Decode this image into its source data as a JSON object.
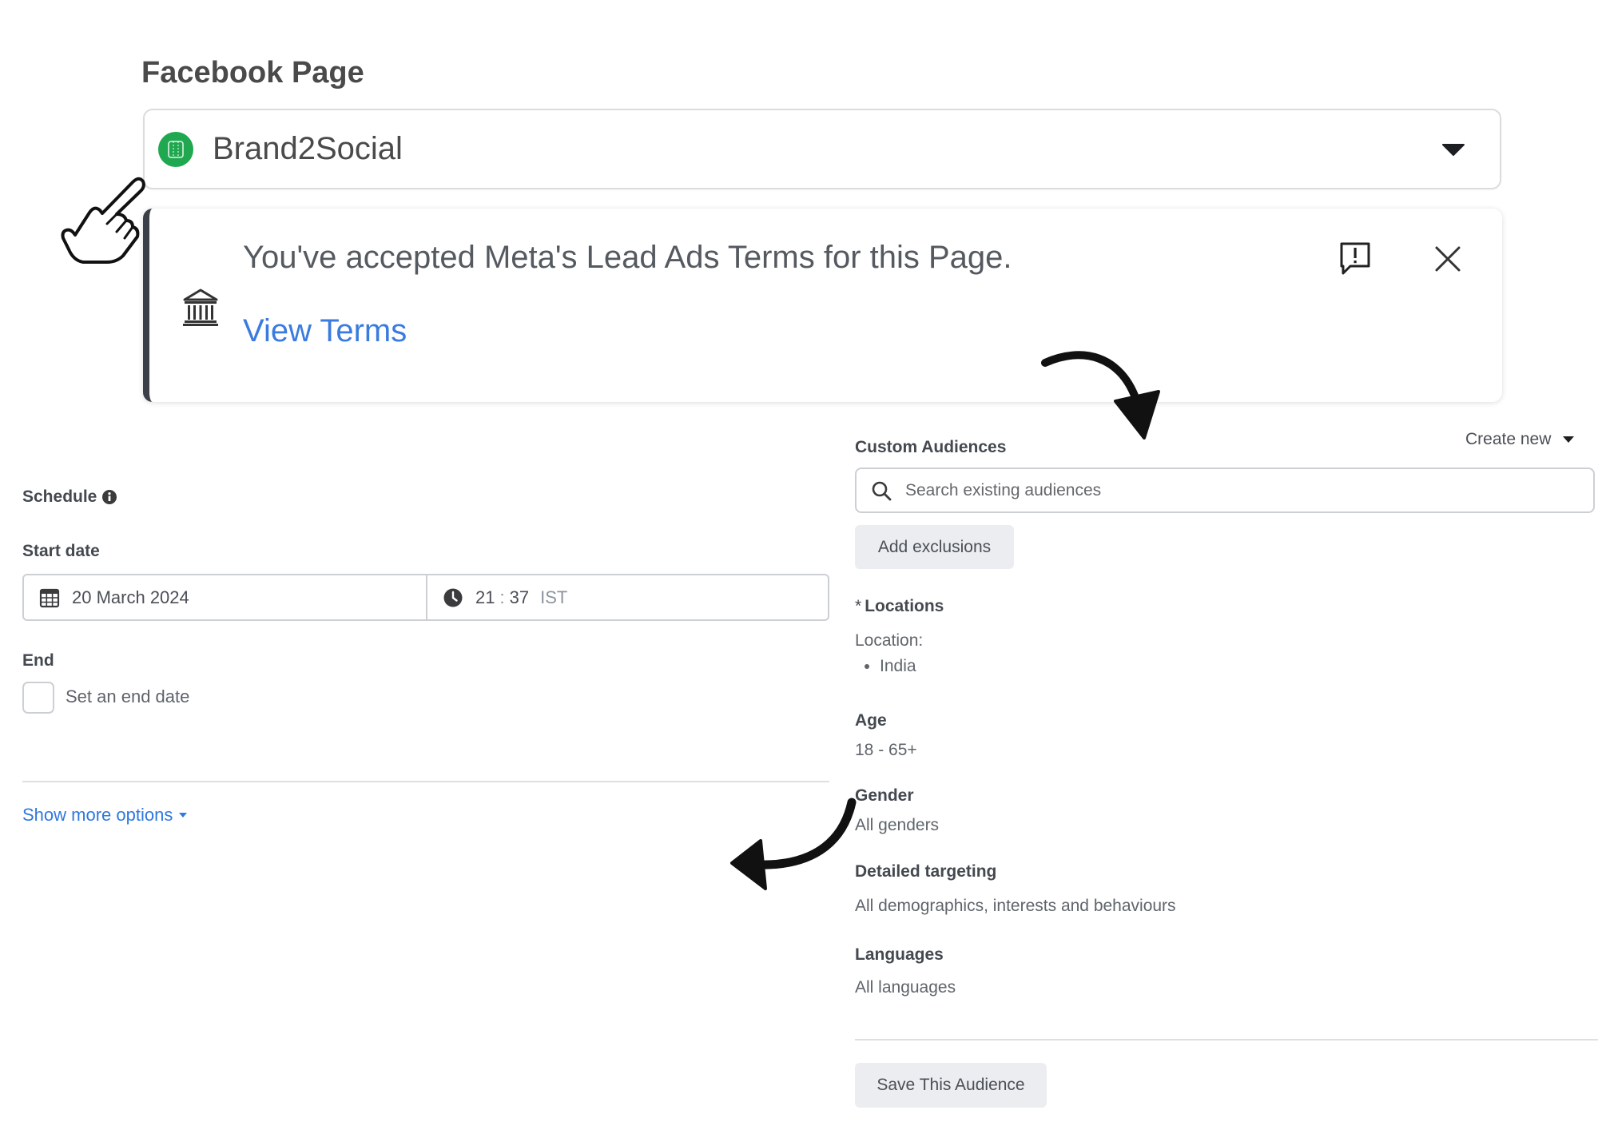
{
  "facebook_page": {
    "heading": "Facebook Page",
    "selected_page": "Brand2Social",
    "avatar_color": "#1fa84f",
    "dropdown_icon": "caret-down-icon"
  },
  "terms_notice": {
    "message": "You've accepted Meta's Lead Ads Terms for this Page.",
    "link_label": "View Terms",
    "link_color": "#3a7be0",
    "accent_color": "#3b4048",
    "icons": [
      "bank-icon",
      "report-icon",
      "close-icon"
    ]
  },
  "schedule": {
    "heading": "Schedule",
    "heading_icon": "info-icon",
    "start_date_label": "Start date",
    "start_date": "20 March 2024",
    "start_hour": "21",
    "time_separator": ":",
    "start_minute": "37",
    "timezone": "IST",
    "end_label": "End",
    "end_checkbox_label": "Set an end date",
    "end_checkbox_checked": false,
    "show_more_label": "Show more options"
  },
  "audience": {
    "custom_audiences_label": "Custom Audiences",
    "create_new_label": "Create new",
    "search_placeholder": "Search existing audiences",
    "add_exclusions_label": "Add exclusions",
    "locations": {
      "required_mark": "*",
      "label": "Locations",
      "sublabel": "Location:",
      "items": [
        "India"
      ]
    },
    "age": {
      "label": "Age",
      "value": "18 - 65+"
    },
    "gender": {
      "label": "Gender",
      "value": "All genders"
    },
    "detailed_targeting": {
      "label": "Detailed targeting",
      "value": "All demographics, interests and behaviours"
    },
    "languages": {
      "label": "Languages",
      "value": "All languages"
    },
    "save_label": "Save This Audience"
  },
  "annotations": {
    "icons": [
      "pointing-hand-icon",
      "curved-arrow-icon",
      "curved-arrow-icon"
    ]
  }
}
